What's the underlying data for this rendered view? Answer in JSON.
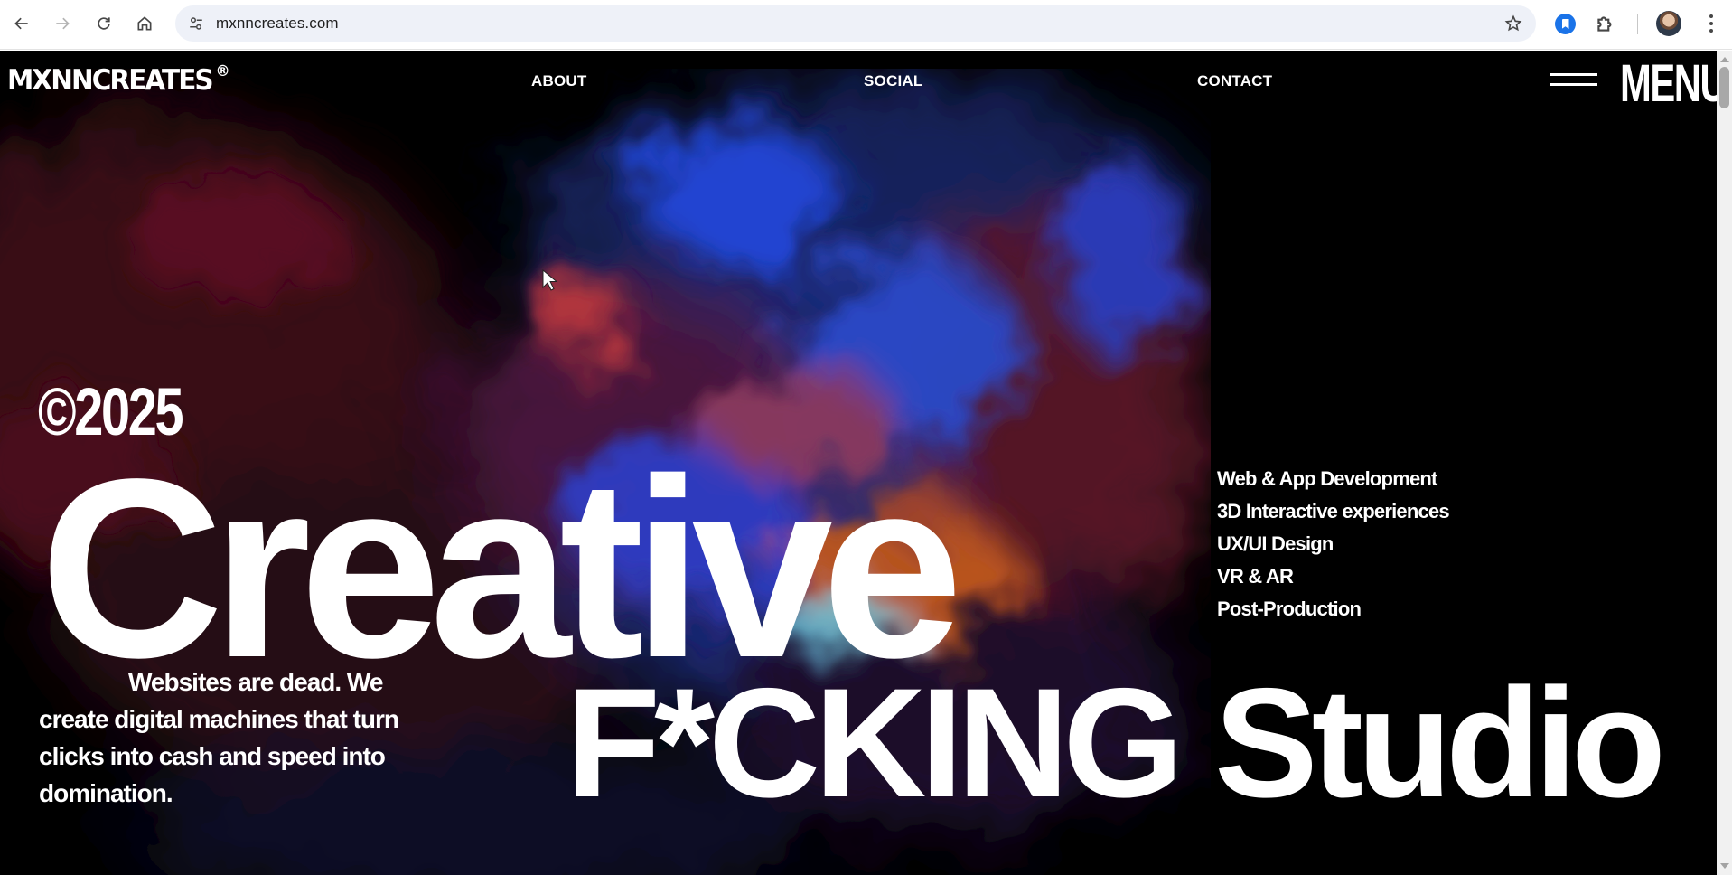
{
  "browser": {
    "url": "mxnncreates.com",
    "icons": {
      "back": "arrow-left-icon",
      "forward": "arrow-right-icon",
      "reload": "reload-icon",
      "home": "home-icon",
      "site_info": "tune-icon",
      "bookmark": "star-icon",
      "extension": "bookmark-extension-icon",
      "extensions_menu": "puzzle-icon",
      "profile": "avatar",
      "more": "kebab-icon"
    },
    "colors": {
      "accent": "#1a73e8",
      "omnibox": "#eef1f8"
    }
  },
  "site": {
    "logo": "MXNNCREATES",
    "logo_mark": "®",
    "nav": {
      "about": "ABOUT",
      "social": "SOCIAL",
      "contact": "CONTACT"
    },
    "menu_label": "MENU"
  },
  "hero": {
    "year": "©2025",
    "headline_1": "Creative",
    "headline_2": "F*CKING Studio",
    "tagline": "Websites are dead. We create digital machines that turn clicks into cash and speed into domination.",
    "services": [
      "Web & App Development",
      "3D Interactive experiences",
      "UX/UI Design",
      "VR & AR",
      "Post-Production"
    ]
  },
  "theme": {
    "background": "#000000",
    "text": "#ffffff",
    "fluid_colors": [
      "#1c3bb8",
      "#7a1a2a",
      "#c85a1e",
      "#7ad8f0"
    ]
  }
}
